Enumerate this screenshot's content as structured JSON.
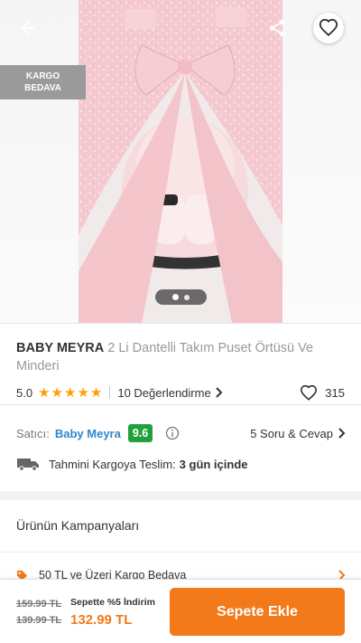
{
  "header": {
    "back_icon": "arrow-left-icon",
    "share_icon": "share-icon",
    "favorite_icon": "heart-icon",
    "badge_line1": "KARGO",
    "badge_line2": "BEDAVA"
  },
  "gallery": {
    "image": "pink lace car seat canopy and cushion set",
    "slide_count": 2,
    "active_slide": 1
  },
  "product": {
    "brand": "BABY MEYRA",
    "name": "2 Li Dantelli Takım Puset Örtüsü Ve Minderi",
    "rating": "5.0",
    "stars": 5,
    "reviews_label": "10 Değerlendirme",
    "likes": "315"
  },
  "seller": {
    "label": "Satıcı:",
    "name": "Baby Meyra",
    "score": "9.6",
    "qa_label": "5 Soru & Cevap",
    "shipping_label": "Tahmini Kargoya Teslim:",
    "shipping_value": "3 gün içinde"
  },
  "campaigns": {
    "title": "Ürünün Kampanyaları",
    "items": [
      {
        "label": "50 TL ve Üzeri Kargo Bedava"
      }
    ]
  },
  "bottom_bar": {
    "old_price_1": "159.99 TL",
    "old_price_2": "139.99 TL",
    "promo_label": "Sepette %5 İndirim",
    "price": "132.99 TL",
    "cart_button": "Sepete Ekle"
  },
  "colors": {
    "accent": "#f27a1a",
    "link": "#2f86d0",
    "score_badge": "#22a13a",
    "star": "#ffa000"
  }
}
